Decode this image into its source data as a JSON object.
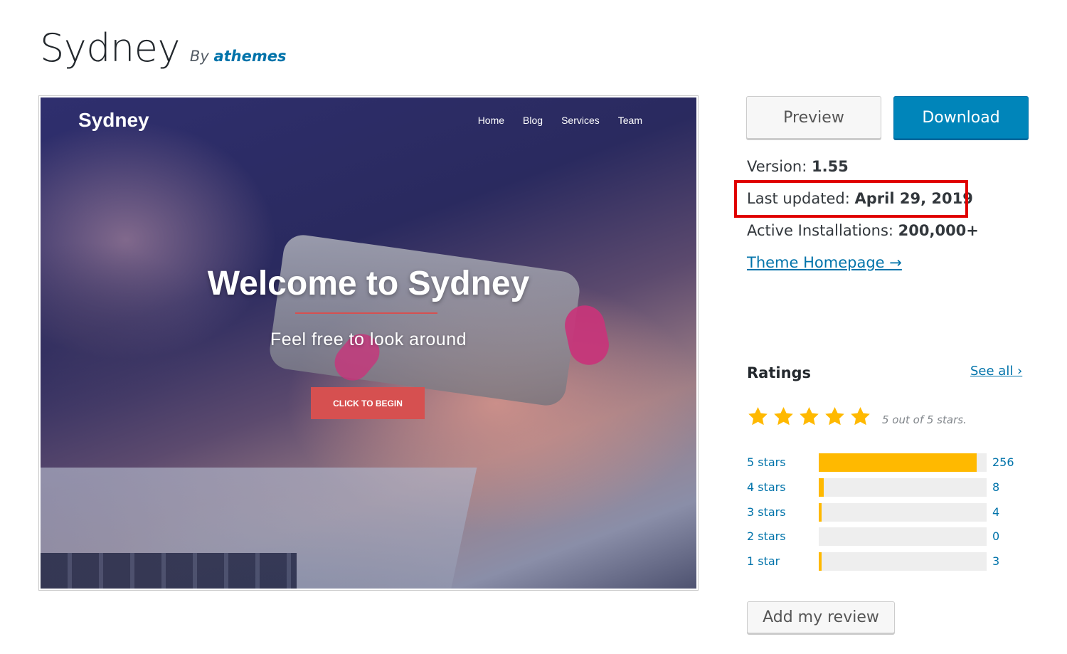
{
  "header": {
    "theme_name": "Sydney",
    "by_prefix": "By",
    "author": "athemes"
  },
  "screenshot": {
    "logo": "Sydney",
    "nav": [
      "Home",
      "Blog",
      "Services",
      "Team"
    ],
    "heading": "Welcome to Sydney",
    "subheading": "Feel free to look around",
    "cta": "CLICK TO BEGIN",
    "accent_color": "#d65050"
  },
  "actions": {
    "preview_label": "Preview",
    "download_label": "Download"
  },
  "meta": {
    "version_label": "Version: ",
    "version_value": "1.55",
    "updated_label": "Last updated: ",
    "updated_value": "April 29, 2019",
    "installs_label": "Active Installations: ",
    "installs_value": "200,000+",
    "homepage_link": "Theme Homepage →",
    "highlight_color": "#e00000"
  },
  "ratings": {
    "title": "Ratings",
    "see_all": "See all ›",
    "average_text": "5 out of 5 stars.",
    "star_count": 5,
    "star_color": "#ffb900",
    "breakdown": [
      {
        "label": "5 stars",
        "count": "256",
        "fraction": 0.94
      },
      {
        "label": "4 stars",
        "count": "8",
        "fraction": 0.03
      },
      {
        "label": "3 stars",
        "count": "4",
        "fraction": 0.015
      },
      {
        "label": "2 stars",
        "count": "0",
        "fraction": 0
      },
      {
        "label": "1 star",
        "count": "3",
        "fraction": 0.012
      }
    ],
    "add_review_label": "Add my review"
  }
}
